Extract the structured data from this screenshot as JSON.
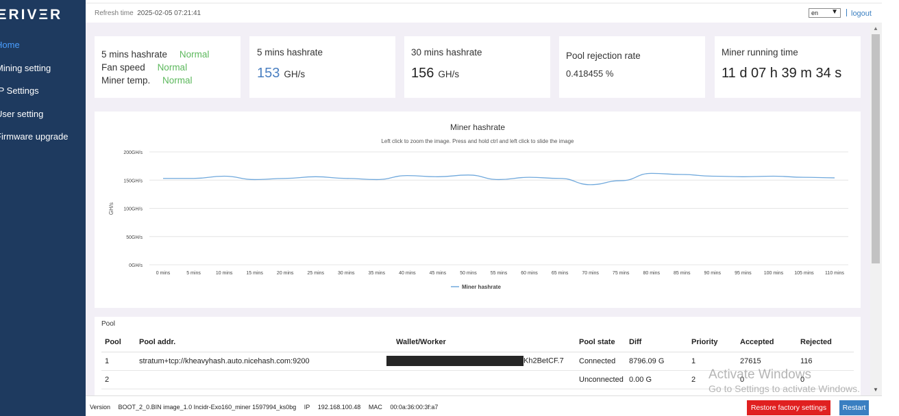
{
  "sidebar": {
    "logo": "ΞRIVΞR",
    "items": [
      {
        "label": "Home"
      },
      {
        "label": "Mining setting"
      },
      {
        "label": "IP Settings"
      },
      {
        "label": "User setting"
      },
      {
        "label": "Firmware upgrade"
      }
    ]
  },
  "header": {
    "refresh_label": "Refresh time",
    "refresh_value": "2025-02-05 07:21:41",
    "language": "en",
    "logout": "logout"
  },
  "status": {
    "hashrate_label": "5 mins hashrate",
    "hashrate_status": "Normal",
    "fan_label": "Fan speed",
    "fan_status": "Normal",
    "temp_label": "Miner temp.",
    "temp_status": "Normal"
  },
  "cards": {
    "h5_title": "5 mins hashrate",
    "h5_value": "153",
    "h5_unit": "GH/s",
    "h30_title": "30 mins hashrate",
    "h30_value": "156",
    "h30_unit": "GH/s",
    "reject_title": "Pool rejection rate",
    "reject_value": "0.418455 %",
    "runtime_title": "Miner running time",
    "runtime_value": "11 d 07 h 39 m 34 s"
  },
  "chart_data": {
    "type": "line",
    "title": "Miner hashrate",
    "subtitle": "Left click to zoom the image. Press and hold ctrl and left click to slide the image",
    "ylabel": "GH/s",
    "xlabel": "",
    "ylim": [
      0,
      200
    ],
    "yticks": [
      "0GH/s",
      "50GH/s",
      "100GH/s",
      "150GH/s",
      "200GH/s"
    ],
    "yticks_values": [
      0,
      50,
      100,
      150,
      200
    ],
    "categories": [
      "0 mins",
      "5 mins",
      "10 mins",
      "15 mins",
      "20 mins",
      "25 mins",
      "30 mins",
      "35 mins",
      "40 mins",
      "45 mins",
      "50 mins",
      "55 mins",
      "60 mins",
      "65 mins",
      "70 mins",
      "75 mins",
      "80 mins",
      "85 mins",
      "90 mins",
      "95 mins",
      "100 mins",
      "105 mins",
      "110 mins"
    ],
    "series": [
      {
        "name": "Miner hashrate",
        "values": [
          153,
          153,
          157,
          151,
          153,
          156,
          153,
          151,
          158,
          156,
          159,
          151,
          155,
          153,
          142,
          149,
          162,
          160,
          157,
          156,
          157,
          155,
          154
        ]
      }
    ],
    "grid": true,
    "legend": "bottom",
    "line_color": "#6fa8dc"
  },
  "pool": {
    "title": "Pool",
    "headers": [
      "Pool",
      "Pool addr.",
      "Wallet/Worker",
      "Pool state",
      "Diff",
      "Priority",
      "Accepted",
      "Rejected"
    ],
    "rows": [
      {
        "pool": "1",
        "addr": "stratum+tcp://kheavyhash.auto.nicehash.com:9200",
        "wallet": "Kh2BetCF.7",
        "state": "Connected",
        "diff": "8796.09 G",
        "priority": "1",
        "accepted": "27615",
        "rejected": "116"
      },
      {
        "pool": "2",
        "addr": "",
        "wallet": "",
        "state": "Unconnected",
        "diff": "0.00 G",
        "priority": "2",
        "accepted": "0",
        "rejected": "0"
      }
    ]
  },
  "footer": {
    "version_label": "Version",
    "version_value": "BOOT_2_0.BIN image_1.0 Incidr-Exo160_miner 1597994_ks0bg",
    "ip_label": "IP",
    "ip_value": "192.168.100.48",
    "mac_label": "MAC",
    "mac_value": "00:0a:36:00:3f:a7",
    "restore_label": "Restore factory settings",
    "restart_label": "Restart"
  },
  "watermark": {
    "line1": "Activate Windows",
    "line2": "Go to Settings to activate Windows."
  }
}
